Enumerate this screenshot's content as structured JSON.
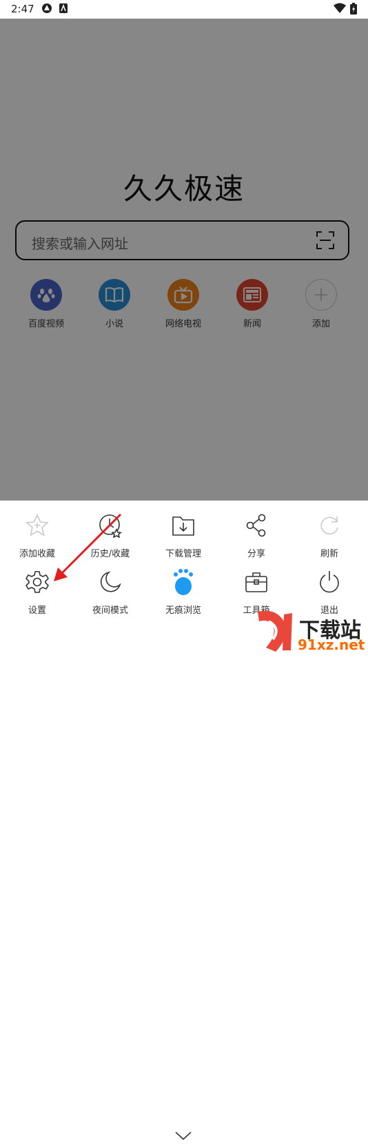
{
  "status": {
    "time": "2:47"
  },
  "home": {
    "title": "久久极速",
    "search_placeholder": "搜索或输入网址",
    "shortcuts": [
      {
        "label": "百度视频",
        "icon": "baidu-paw-icon",
        "color": "#4a63c8"
      },
      {
        "label": "小说",
        "icon": "book-icon",
        "color": "#2b8fd6"
      },
      {
        "label": "网络电视",
        "icon": "tv-icon",
        "color": "#f0831c"
      },
      {
        "label": "新闻",
        "icon": "news-icon",
        "color": "#e5452f"
      },
      {
        "label": "添加",
        "icon": "plus-icon",
        "color": "#cccccc"
      }
    ]
  },
  "menu": {
    "row1": [
      {
        "label": "添加收藏",
        "icon": "star-add-icon",
        "enabled": false
      },
      {
        "label": "历史/收藏",
        "icon": "history-icon",
        "enabled": true
      },
      {
        "label": "下载管理",
        "icon": "download-folder-icon",
        "enabled": true
      },
      {
        "label": "分享",
        "icon": "share-icon",
        "enabled": true
      },
      {
        "label": "刷新",
        "icon": "refresh-icon",
        "enabled": false
      }
    ],
    "row2": [
      {
        "label": "设置",
        "icon": "gear-icon",
        "enabled": true
      },
      {
        "label": "夜间模式",
        "icon": "moon-icon",
        "enabled": true
      },
      {
        "label": "无痕浏览",
        "icon": "paw-incognito-icon",
        "enabled": true,
        "color": "#1e9bf0"
      },
      {
        "label": "工具箱",
        "icon": "toolbox-icon",
        "enabled": true
      },
      {
        "label": "退出",
        "icon": "power-icon",
        "enabled": true
      }
    ]
  },
  "watermark": {
    "text": "下载站",
    "url": "91xz.net"
  },
  "colors": {
    "dim_overlay": "#000000",
    "annotation_arrow": "#e02020"
  }
}
